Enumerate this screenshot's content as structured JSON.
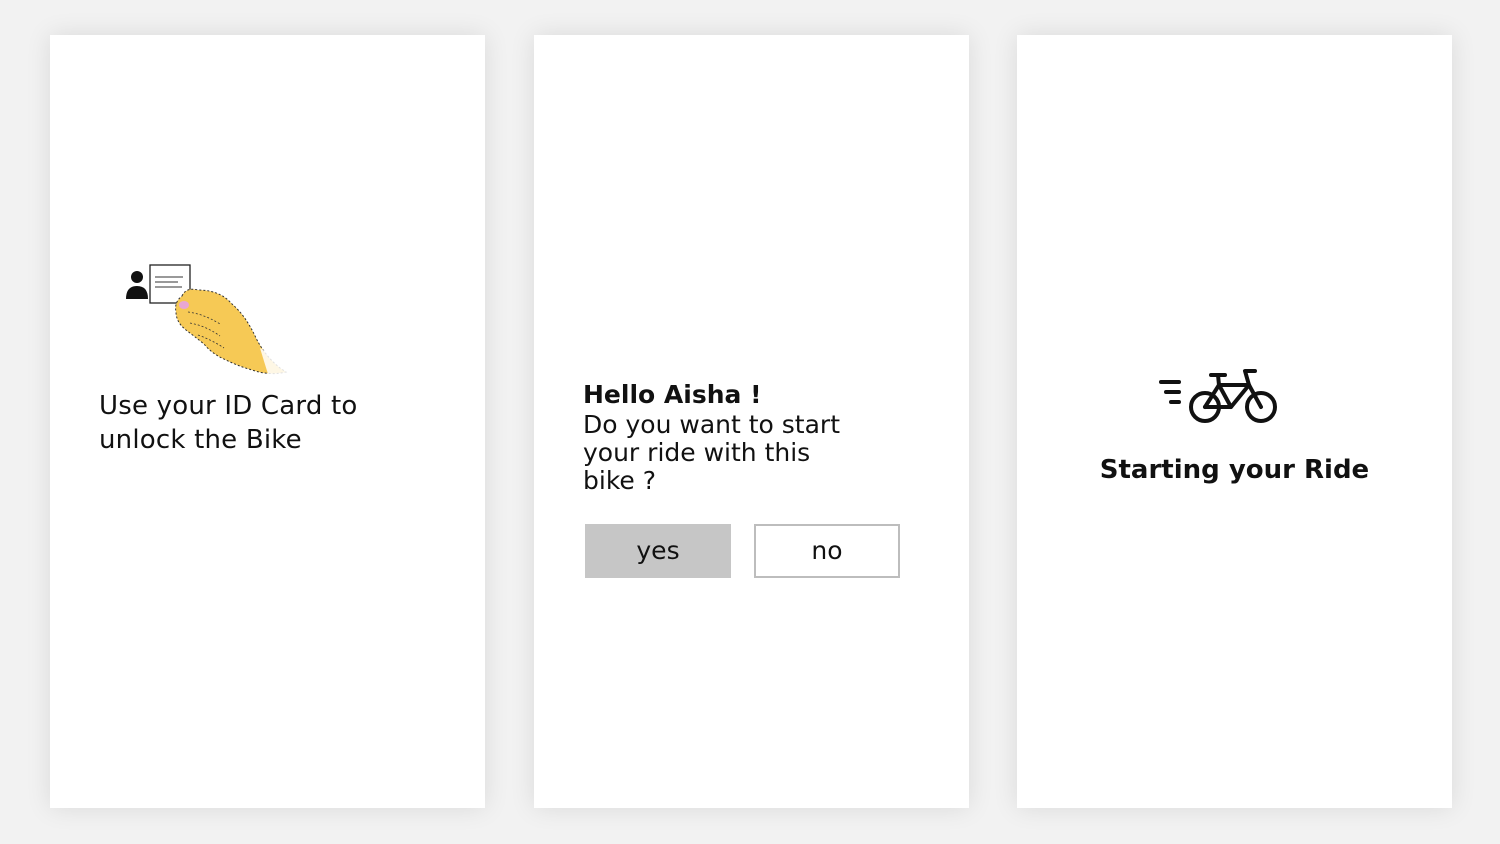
{
  "screens": {
    "unlock": {
      "illustration_icon": "hand-holding-id-card-icon",
      "instruction_lines": [
        "Use your ID Card to",
        "unlock the Bike"
      ]
    },
    "confirm": {
      "greeting": "Hello Aisha !",
      "question_lines": [
        "Do you want to start",
        "your ride with this",
        "bike ?"
      ],
      "yes_label": "yes",
      "no_label": "no"
    },
    "starting": {
      "icon": "speeding-bicycle-icon",
      "title": "Starting your Ride"
    }
  },
  "colors": {
    "background": "#f2f2f2",
    "card": "#ffffff",
    "text": "#111111",
    "hand": "#f6c955",
    "nail": "#e9a7d3",
    "yes_button": "#c6c6c6",
    "no_button_border": "#bdbdbd"
  }
}
